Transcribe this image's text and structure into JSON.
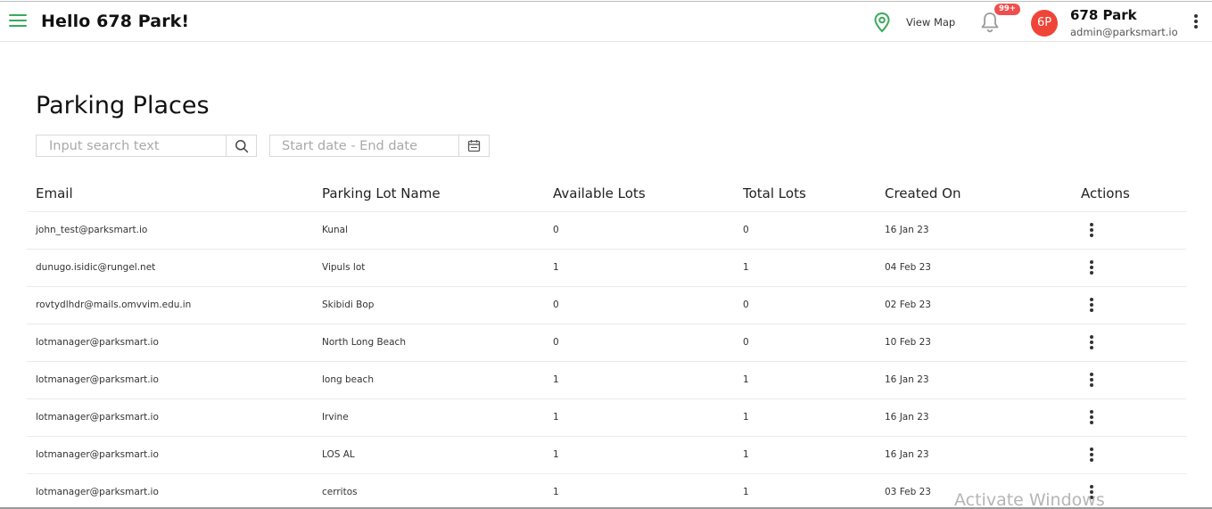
{
  "header": {
    "greeting": "Hello 678 Park!",
    "view_map_label": "View Map",
    "notification_badge": "99+",
    "avatar_initials": "6P",
    "user_name": "678 Park",
    "user_email": "admin@parksmart.io"
  },
  "page": {
    "title": "Parking Places"
  },
  "filters": {
    "search_placeholder": "Input search text",
    "date_placeholder": "Start date - End date"
  },
  "table": {
    "columns": [
      "Email",
      "Parking Lot Name",
      "Available Lots",
      "Total Lots",
      "Created On",
      "Actions"
    ],
    "rows": [
      {
        "email": "john_test@parksmart.io",
        "name": "Kunal",
        "available": "0",
        "total": "0",
        "created": "16 Jan 23"
      },
      {
        "email": "dunugo.isidic@rungel.net",
        "name": "Vipuls lot",
        "available": "1",
        "total": "1",
        "created": "04 Feb 23"
      },
      {
        "email": "rovtydlhdr@mails.omvvim.edu.in",
        "name": "Skibidi Bop",
        "available": "0",
        "total": "0",
        "created": "02 Feb 23"
      },
      {
        "email": "lotmanager@parksmart.io",
        "name": "North Long Beach",
        "available": "0",
        "total": "0",
        "created": "10 Feb 23"
      },
      {
        "email": "lotmanager@parksmart.io",
        "name": "long beach",
        "available": "1",
        "total": "1",
        "created": "16 Jan 23"
      },
      {
        "email": "lotmanager@parksmart.io",
        "name": "Irvine",
        "available": "1",
        "total": "1",
        "created": "16 Jan 23"
      },
      {
        "email": "lotmanager@parksmart.io",
        "name": "LOS AL",
        "available": "1",
        "total": "1",
        "created": "16 Jan 23"
      },
      {
        "email": "lotmanager@parksmart.io",
        "name": "cerritos",
        "available": "1",
        "total": "1",
        "created": "03 Feb 23"
      }
    ]
  },
  "watermark": "Activate Windows",
  "icons": {
    "menu": "hamburger-icon",
    "map": "map-pin-icon",
    "notifications": "bell-icon",
    "more": "more-vertical-icon",
    "search": "search-icon",
    "calendar": "calendar-icon"
  },
  "colors": {
    "accent": "#3aa95a",
    "badge": "#f04e4e",
    "avatar": "#ef4438"
  }
}
